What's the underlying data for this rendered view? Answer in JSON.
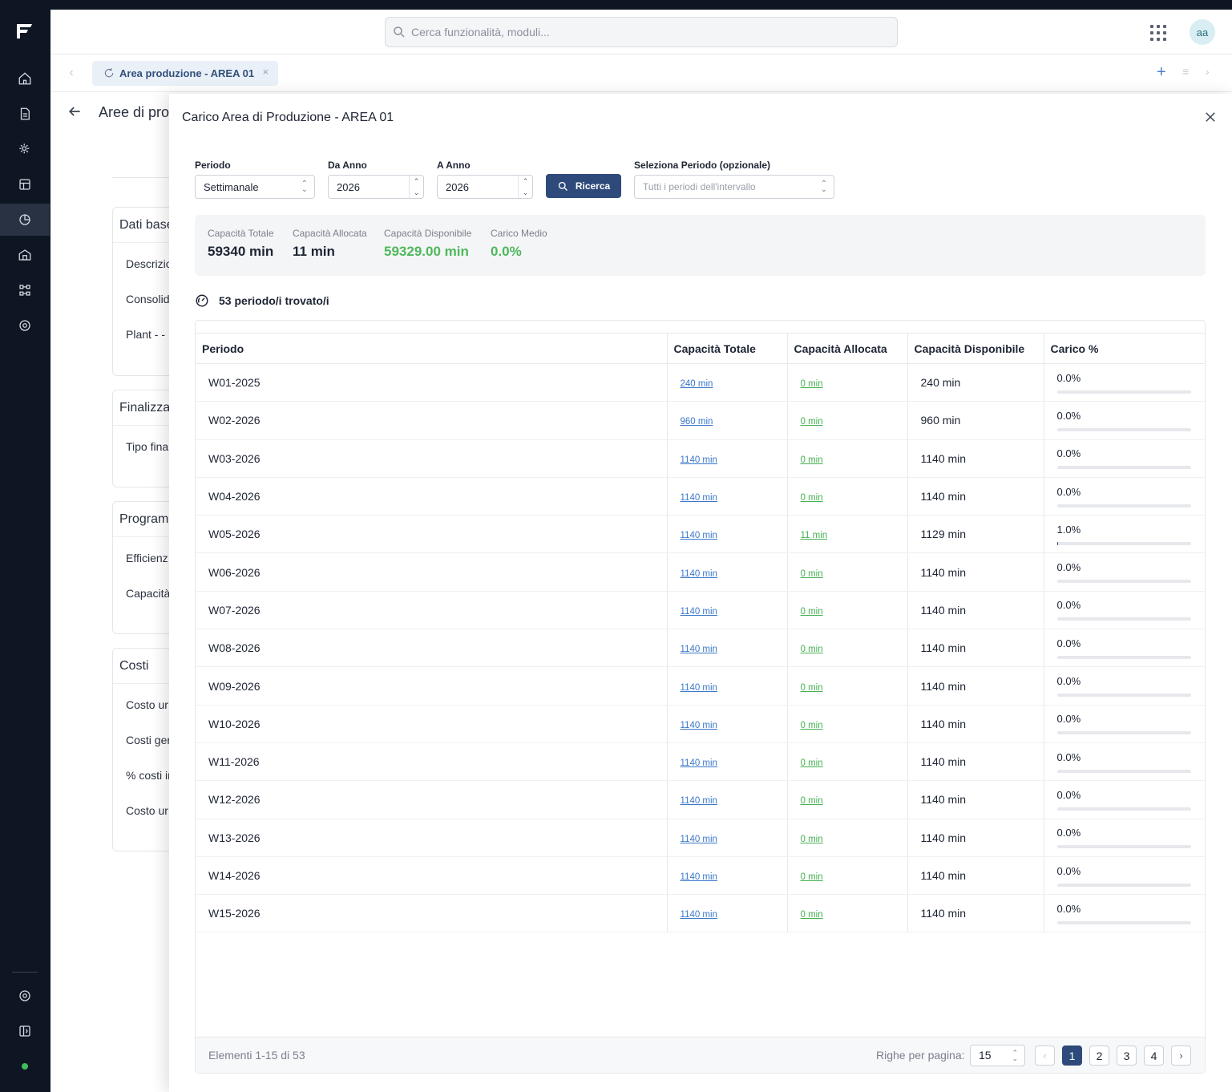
{
  "topbar": {
    "search_placeholder": "Cerca funzionalità, moduli...",
    "avatar_initials": "aa"
  },
  "tabbar": {
    "active_tab": "Area produzione - AREA 01"
  },
  "background_page": {
    "title": "Aree di pro",
    "cards": [
      {
        "title": "Dati base",
        "fields": [
          "Descrizio",
          "Consolid",
          "Plant  - -"
        ]
      },
      {
        "title": "Finalizza",
        "fields": [
          "Tipo fina"
        ]
      },
      {
        "title": "Program",
        "fields": [
          "Efficienz",
          "Capacità"
        ]
      },
      {
        "title": "Costi",
        "fields": [
          "Costo ur",
          "Costi ger",
          "% costi ir",
          "Costo ur"
        ]
      }
    ]
  },
  "modal": {
    "title": "Carico Area di Produzione - AREA 01",
    "filters": {
      "periodo_label": "Periodo",
      "periodo_value": "Settimanale",
      "da_anno_label": "Da Anno",
      "da_anno_value": "2026",
      "a_anno_label": "A Anno",
      "a_anno_value": "2026",
      "search_button": "Ricerca",
      "seleziona_label": "Seleziona Periodo (opzionale)",
      "seleziona_placeholder": "Tutti i periodi dell'intervallo"
    },
    "summary": {
      "capacita_totale_label": "Capacità Totale",
      "capacita_totale_value": "59340 min",
      "capacita_allocata_label": "Capacità Allocata",
      "capacita_allocata_value": "11 min",
      "capacita_disponibile_label": "Capacità Disponibile",
      "capacita_disponibile_value": "59329.00 min",
      "carico_medio_label": "Carico Medio",
      "carico_medio_value": "0.0%"
    },
    "found_text": "53 periodo/i trovato/i",
    "table": {
      "headers": [
        "Periodo",
        "Capacità Totale",
        "Capacità Allocata",
        "Capacità Disponibile",
        "Carico %"
      ],
      "rows": [
        {
          "periodo": "W01-2025",
          "totale": "240 min",
          "allocata": "0 min",
          "disponibile": "240 min",
          "carico": "0.0%",
          "load_fraction": 0.0
        },
        {
          "periodo": "W02-2026",
          "totale": "960 min",
          "allocata": "0 min",
          "disponibile": "960 min",
          "carico": "0.0%",
          "load_fraction": 0.0
        },
        {
          "periodo": "W03-2026",
          "totale": "1140 min",
          "allocata": "0 min",
          "disponibile": "1140 min",
          "carico": "0.0%",
          "load_fraction": 0.0
        },
        {
          "periodo": "W04-2026",
          "totale": "1140 min",
          "allocata": "0 min",
          "disponibile": "1140 min",
          "carico": "0.0%",
          "load_fraction": 0.0
        },
        {
          "periodo": "W05-2026",
          "totale": "1140 min",
          "allocata": "11 min",
          "disponibile": "1129 min",
          "carico": "1.0%",
          "load_fraction": 0.01
        },
        {
          "periodo": "W06-2026",
          "totale": "1140 min",
          "allocata": "0 min",
          "disponibile": "1140 min",
          "carico": "0.0%",
          "load_fraction": 0.0
        },
        {
          "periodo": "W07-2026",
          "totale": "1140 min",
          "allocata": "0 min",
          "disponibile": "1140 min",
          "carico": "0.0%",
          "load_fraction": 0.0
        },
        {
          "periodo": "W08-2026",
          "totale": "1140 min",
          "allocata": "0 min",
          "disponibile": "1140 min",
          "carico": "0.0%",
          "load_fraction": 0.0
        },
        {
          "periodo": "W09-2026",
          "totale": "1140 min",
          "allocata": "0 min",
          "disponibile": "1140 min",
          "carico": "0.0%",
          "load_fraction": 0.0
        },
        {
          "periodo": "W10-2026",
          "totale": "1140 min",
          "allocata": "0 min",
          "disponibile": "1140 min",
          "carico": "0.0%",
          "load_fraction": 0.0
        },
        {
          "periodo": "W11-2026",
          "totale": "1140 min",
          "allocata": "0 min",
          "disponibile": "1140 min",
          "carico": "0.0%",
          "load_fraction": 0.0
        },
        {
          "periodo": "W12-2026",
          "totale": "1140 min",
          "allocata": "0 min",
          "disponibile": "1140 min",
          "carico": "0.0%",
          "load_fraction": 0.0
        },
        {
          "periodo": "W13-2026",
          "totale": "1140 min",
          "allocata": "0 min",
          "disponibile": "1140 min",
          "carico": "0.0%",
          "load_fraction": 0.0
        },
        {
          "periodo": "W14-2026",
          "totale": "1140 min",
          "allocata": "0 min",
          "disponibile": "1140 min",
          "carico": "0.0%",
          "load_fraction": 0.0
        },
        {
          "periodo": "W15-2026",
          "totale": "1140 min",
          "allocata": "0 min",
          "disponibile": "1140 min",
          "carico": "0.0%",
          "load_fraction": 0.0
        }
      ]
    },
    "pagination": {
      "count_text": "Elementi 1-15 di 53",
      "rows_per_page_label": "Righe per pagina:",
      "rows_per_page_value": "15",
      "pages": [
        "1",
        "2",
        "3",
        "4"
      ],
      "current_page": "1"
    }
  },
  "colors": {
    "sidebar_bg": "#0f1623",
    "primary": "#2d4a7a",
    "link_blue": "#3a78c9",
    "green": "#4eb85a"
  }
}
